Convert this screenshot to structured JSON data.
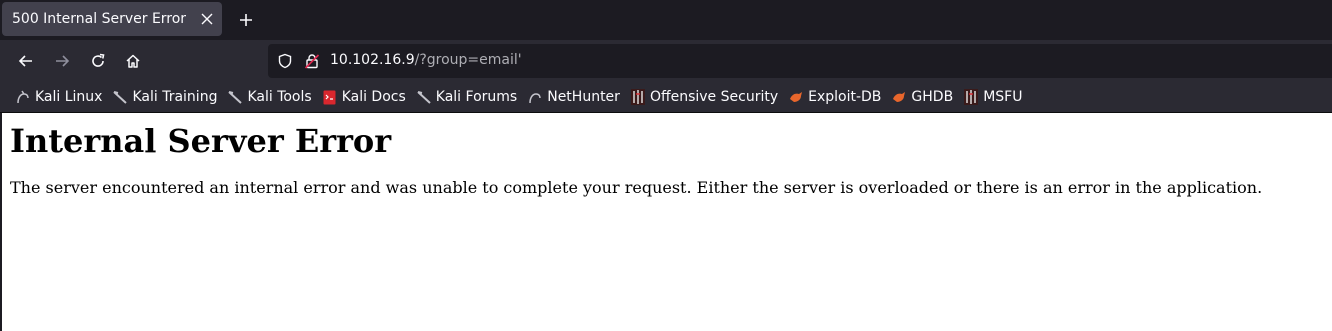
{
  "tab": {
    "title": "500 Internal Server Error"
  },
  "url": {
    "host": "10.102.16.9",
    "path": "/?group=email'"
  },
  "bookmarks": [
    {
      "label": "Kali Linux",
      "icon": "kali-dragon-icon"
    },
    {
      "label": "Kali Training",
      "icon": "kali-dragon-icon"
    },
    {
      "label": "Kali Tools",
      "icon": "kali-dragon-icon"
    },
    {
      "label": "Kali Docs",
      "icon": "kali-docs-icon"
    },
    {
      "label": "Kali Forums",
      "icon": "kali-dragon-icon"
    },
    {
      "label": "NetHunter",
      "icon": "nethunter-icon"
    },
    {
      "label": "Offensive Security",
      "icon": "offsec-icon"
    },
    {
      "label": "Exploit-DB",
      "icon": "exploitdb-icon"
    },
    {
      "label": "GHDB",
      "icon": "exploitdb-icon"
    },
    {
      "label": "MSFU",
      "icon": "offsec-icon"
    }
  ],
  "page": {
    "heading": "Internal Server Error",
    "message": "The server encountered an internal error and was unable to complete your request. Either the server is overloaded or there is an error in the application."
  }
}
